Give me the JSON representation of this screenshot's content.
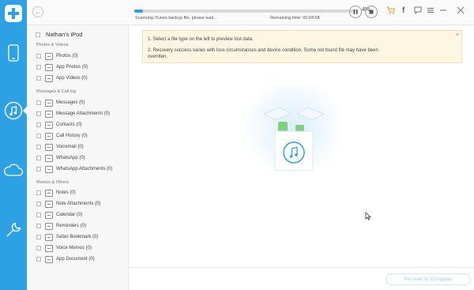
{
  "colors": {
    "brand": "#2ea1e4",
    "accent_cart": "#f0a020",
    "notice_bg": "#fdf6e3"
  },
  "topbar": {
    "progress_fraction": 0.04,
    "progress_percent": "4%",
    "status": "Scanning iTunes backup file, please wait...",
    "remaining": "Remaining time: 00:04:58",
    "icons": [
      "back-icon",
      "pause-icon",
      "stop-icon",
      "cart-icon",
      "facebook-icon",
      "feedback-icon",
      "menu-icon",
      "minimize-icon",
      "close-icon"
    ]
  },
  "rail": {
    "icons": [
      "logo-icon",
      "phone-icon",
      "music-icon",
      "cloud-icon",
      "wrench-icon"
    ]
  },
  "panel": {
    "device_name": "Nathan's iPod",
    "sections": [
      {
        "label": "Photos & Videos",
        "items": [
          "Photos (0)",
          "App Photos (0)",
          "App Videos (0)"
        ]
      },
      {
        "label": "Messages & Call log",
        "items": [
          "Messages (0)",
          "Message Attachments (0)",
          "Contacts (0)",
          "Call History (0)",
          "Voicemail (0)",
          "WhatsApp (0)",
          "WhatsApp Attachments (0)"
        ]
      },
      {
        "label": "Memos & Others",
        "items": [
          "Notes (0)",
          "Note Attachments (0)",
          "Calendar (0)",
          "Reminders (0)",
          "Safari Bookmark (0)",
          "Voice Memos (0)",
          "App Document (0)"
        ]
      }
    ]
  },
  "notice": {
    "line1": "1. Select a file type on the left to preview lost data.",
    "line2": "2. Recovery success varies with loss circumstances and device condition. Some not found file may have been",
    "line3": "overriten.",
    "close": "×"
  },
  "bottombar": {
    "recover_label": "Recover to Computer"
  }
}
